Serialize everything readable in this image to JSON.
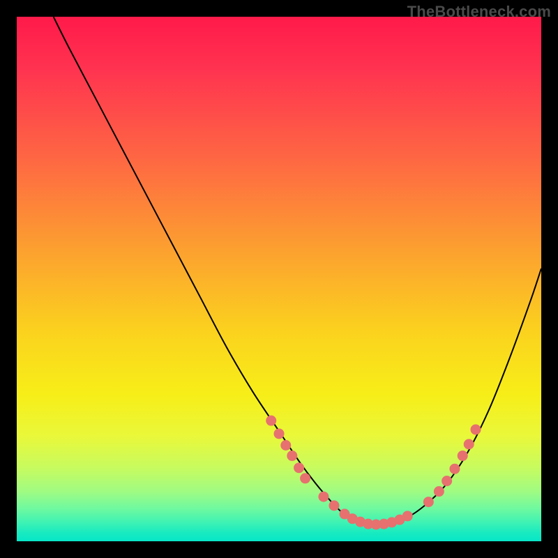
{
  "brand": {
    "watermark": "TheBottleneck.com"
  },
  "colors": {
    "frame": "#000000",
    "curve": "#000000",
    "dot_fill": "#e6716f",
    "gradient_stops": [
      {
        "offset": 0.0,
        "color": "#ff1a4a"
      },
      {
        "offset": 0.1,
        "color": "#ff3350"
      },
      {
        "offset": 0.28,
        "color": "#fe6a42"
      },
      {
        "offset": 0.45,
        "color": "#fca22f"
      },
      {
        "offset": 0.6,
        "color": "#fbd21e"
      },
      {
        "offset": 0.72,
        "color": "#f7ee18"
      },
      {
        "offset": 0.8,
        "color": "#e9f83a"
      },
      {
        "offset": 0.86,
        "color": "#c7fb5f"
      },
      {
        "offset": 0.905,
        "color": "#a0fb82"
      },
      {
        "offset": 0.938,
        "color": "#6ef9a0"
      },
      {
        "offset": 0.965,
        "color": "#3cf2b4"
      },
      {
        "offset": 0.985,
        "color": "#17eac1"
      },
      {
        "offset": 1.0,
        "color": "#07e6c8"
      }
    ]
  },
  "chart_data": {
    "type": "line",
    "title": "",
    "xlabel": "",
    "ylabel": "",
    "xlim": [
      0,
      100
    ],
    "ylim": [
      0,
      100
    ],
    "grid": false,
    "legend": false,
    "description": "V-shaped bottleneck curve on vertical rainbow heat gradient; minimum sits on the green band near the bottom.",
    "series": [
      {
        "name": "bottleneck-curve",
        "x": [
          7,
          10,
          15,
          20,
          25,
          30,
          35,
          40,
          45,
          50,
          54,
          57,
          60,
          62,
          64,
          66,
          70,
          74,
          78,
          82,
          86,
          90,
          94,
          98,
          100
        ],
        "y": [
          100,
          94,
          84.5,
          75,
          65.5,
          56,
          46.5,
          37,
          28.5,
          21,
          15,
          11,
          7.5,
          5.5,
          4,
          3.2,
          3.2,
          4.3,
          7,
          11,
          17,
          25,
          35,
          46,
          52
        ]
      }
    ],
    "markers": {
      "name": "highlight-dots",
      "note": "salmon dots clustered along the curve near the valley and on both slopes around y≈10–20",
      "points": [
        {
          "x": 48.5,
          "y": 23
        },
        {
          "x": 50.0,
          "y": 20.5
        },
        {
          "x": 51.3,
          "y": 18.3
        },
        {
          "x": 52.5,
          "y": 16.3
        },
        {
          "x": 53.8,
          "y": 14.0
        },
        {
          "x": 55.0,
          "y": 12.0
        },
        {
          "x": 58.5,
          "y": 8.5
        },
        {
          "x": 60.5,
          "y": 6.8
        },
        {
          "x": 62.5,
          "y": 5.2
        },
        {
          "x": 64.0,
          "y": 4.3
        },
        {
          "x": 65.5,
          "y": 3.7
        },
        {
          "x": 67.0,
          "y": 3.3
        },
        {
          "x": 68.5,
          "y": 3.2
        },
        {
          "x": 70.0,
          "y": 3.3
        },
        {
          "x": 71.5,
          "y": 3.6
        },
        {
          "x": 73.0,
          "y": 4.1
        },
        {
          "x": 74.5,
          "y": 4.8
        },
        {
          "x": 78.5,
          "y": 7.5
        },
        {
          "x": 80.5,
          "y": 9.5
        },
        {
          "x": 82.0,
          "y": 11.5
        },
        {
          "x": 83.5,
          "y": 13.8
        },
        {
          "x": 85.0,
          "y": 16.3
        },
        {
          "x": 86.2,
          "y": 18.5
        },
        {
          "x": 87.5,
          "y": 21.3
        }
      ]
    }
  }
}
